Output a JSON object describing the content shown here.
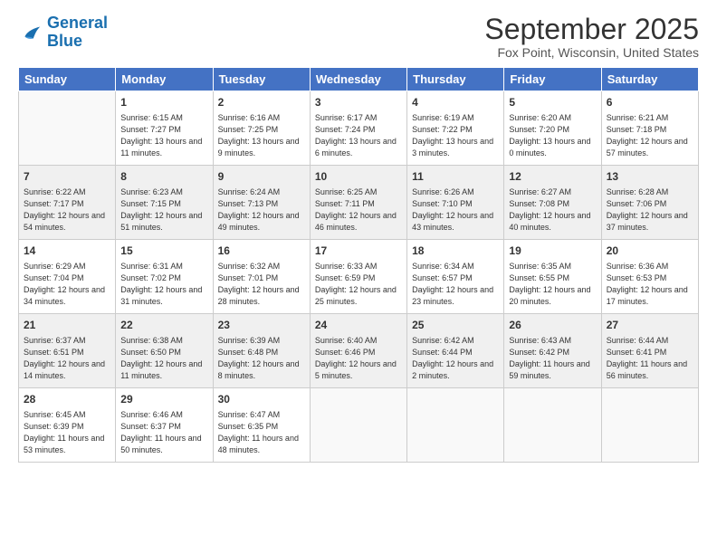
{
  "logo": {
    "line1": "General",
    "line2": "Blue"
  },
  "title": "September 2025",
  "location": "Fox Point, Wisconsin, United States",
  "weekdays": [
    "Sunday",
    "Monday",
    "Tuesday",
    "Wednesday",
    "Thursday",
    "Friday",
    "Saturday"
  ],
  "weeks": [
    [
      {
        "day": "",
        "sunrise": "",
        "sunset": "",
        "daylight": ""
      },
      {
        "day": "1",
        "sunrise": "Sunrise: 6:15 AM",
        "sunset": "Sunset: 7:27 PM",
        "daylight": "Daylight: 13 hours and 11 minutes."
      },
      {
        "day": "2",
        "sunrise": "Sunrise: 6:16 AM",
        "sunset": "Sunset: 7:25 PM",
        "daylight": "Daylight: 13 hours and 9 minutes."
      },
      {
        "day": "3",
        "sunrise": "Sunrise: 6:17 AM",
        "sunset": "Sunset: 7:24 PM",
        "daylight": "Daylight: 13 hours and 6 minutes."
      },
      {
        "day": "4",
        "sunrise": "Sunrise: 6:19 AM",
        "sunset": "Sunset: 7:22 PM",
        "daylight": "Daylight: 13 hours and 3 minutes."
      },
      {
        "day": "5",
        "sunrise": "Sunrise: 6:20 AM",
        "sunset": "Sunset: 7:20 PM",
        "daylight": "Daylight: 13 hours and 0 minutes."
      },
      {
        "day": "6",
        "sunrise": "Sunrise: 6:21 AM",
        "sunset": "Sunset: 7:18 PM",
        "daylight": "Daylight: 12 hours and 57 minutes."
      }
    ],
    [
      {
        "day": "7",
        "sunrise": "Sunrise: 6:22 AM",
        "sunset": "Sunset: 7:17 PM",
        "daylight": "Daylight: 12 hours and 54 minutes."
      },
      {
        "day": "8",
        "sunrise": "Sunrise: 6:23 AM",
        "sunset": "Sunset: 7:15 PM",
        "daylight": "Daylight: 12 hours and 51 minutes."
      },
      {
        "day": "9",
        "sunrise": "Sunrise: 6:24 AM",
        "sunset": "Sunset: 7:13 PM",
        "daylight": "Daylight: 12 hours and 49 minutes."
      },
      {
        "day": "10",
        "sunrise": "Sunrise: 6:25 AM",
        "sunset": "Sunset: 7:11 PM",
        "daylight": "Daylight: 12 hours and 46 minutes."
      },
      {
        "day": "11",
        "sunrise": "Sunrise: 6:26 AM",
        "sunset": "Sunset: 7:10 PM",
        "daylight": "Daylight: 12 hours and 43 minutes."
      },
      {
        "day": "12",
        "sunrise": "Sunrise: 6:27 AM",
        "sunset": "Sunset: 7:08 PM",
        "daylight": "Daylight: 12 hours and 40 minutes."
      },
      {
        "day": "13",
        "sunrise": "Sunrise: 6:28 AM",
        "sunset": "Sunset: 7:06 PM",
        "daylight": "Daylight: 12 hours and 37 minutes."
      }
    ],
    [
      {
        "day": "14",
        "sunrise": "Sunrise: 6:29 AM",
        "sunset": "Sunset: 7:04 PM",
        "daylight": "Daylight: 12 hours and 34 minutes."
      },
      {
        "day": "15",
        "sunrise": "Sunrise: 6:31 AM",
        "sunset": "Sunset: 7:02 PM",
        "daylight": "Daylight: 12 hours and 31 minutes."
      },
      {
        "day": "16",
        "sunrise": "Sunrise: 6:32 AM",
        "sunset": "Sunset: 7:01 PM",
        "daylight": "Daylight: 12 hours and 28 minutes."
      },
      {
        "day": "17",
        "sunrise": "Sunrise: 6:33 AM",
        "sunset": "Sunset: 6:59 PM",
        "daylight": "Daylight: 12 hours and 25 minutes."
      },
      {
        "day": "18",
        "sunrise": "Sunrise: 6:34 AM",
        "sunset": "Sunset: 6:57 PM",
        "daylight": "Daylight: 12 hours and 23 minutes."
      },
      {
        "day": "19",
        "sunrise": "Sunrise: 6:35 AM",
        "sunset": "Sunset: 6:55 PM",
        "daylight": "Daylight: 12 hours and 20 minutes."
      },
      {
        "day": "20",
        "sunrise": "Sunrise: 6:36 AM",
        "sunset": "Sunset: 6:53 PM",
        "daylight": "Daylight: 12 hours and 17 minutes."
      }
    ],
    [
      {
        "day": "21",
        "sunrise": "Sunrise: 6:37 AM",
        "sunset": "Sunset: 6:51 PM",
        "daylight": "Daylight: 12 hours and 14 minutes."
      },
      {
        "day": "22",
        "sunrise": "Sunrise: 6:38 AM",
        "sunset": "Sunset: 6:50 PM",
        "daylight": "Daylight: 12 hours and 11 minutes."
      },
      {
        "day": "23",
        "sunrise": "Sunrise: 6:39 AM",
        "sunset": "Sunset: 6:48 PM",
        "daylight": "Daylight: 12 hours and 8 minutes."
      },
      {
        "day": "24",
        "sunrise": "Sunrise: 6:40 AM",
        "sunset": "Sunset: 6:46 PM",
        "daylight": "Daylight: 12 hours and 5 minutes."
      },
      {
        "day": "25",
        "sunrise": "Sunrise: 6:42 AM",
        "sunset": "Sunset: 6:44 PM",
        "daylight": "Daylight: 12 hours and 2 minutes."
      },
      {
        "day": "26",
        "sunrise": "Sunrise: 6:43 AM",
        "sunset": "Sunset: 6:42 PM",
        "daylight": "Daylight: 11 hours and 59 minutes."
      },
      {
        "day": "27",
        "sunrise": "Sunrise: 6:44 AM",
        "sunset": "Sunset: 6:41 PM",
        "daylight": "Daylight: 11 hours and 56 minutes."
      }
    ],
    [
      {
        "day": "28",
        "sunrise": "Sunrise: 6:45 AM",
        "sunset": "Sunset: 6:39 PM",
        "daylight": "Daylight: 11 hours and 53 minutes."
      },
      {
        "day": "29",
        "sunrise": "Sunrise: 6:46 AM",
        "sunset": "Sunset: 6:37 PM",
        "daylight": "Daylight: 11 hours and 50 minutes."
      },
      {
        "day": "30",
        "sunrise": "Sunrise: 6:47 AM",
        "sunset": "Sunset: 6:35 PM",
        "daylight": "Daylight: 11 hours and 48 minutes."
      },
      {
        "day": "",
        "sunrise": "",
        "sunset": "",
        "daylight": ""
      },
      {
        "day": "",
        "sunrise": "",
        "sunset": "",
        "daylight": ""
      },
      {
        "day": "",
        "sunrise": "",
        "sunset": "",
        "daylight": ""
      },
      {
        "day": "",
        "sunrise": "",
        "sunset": "",
        "daylight": ""
      }
    ]
  ]
}
